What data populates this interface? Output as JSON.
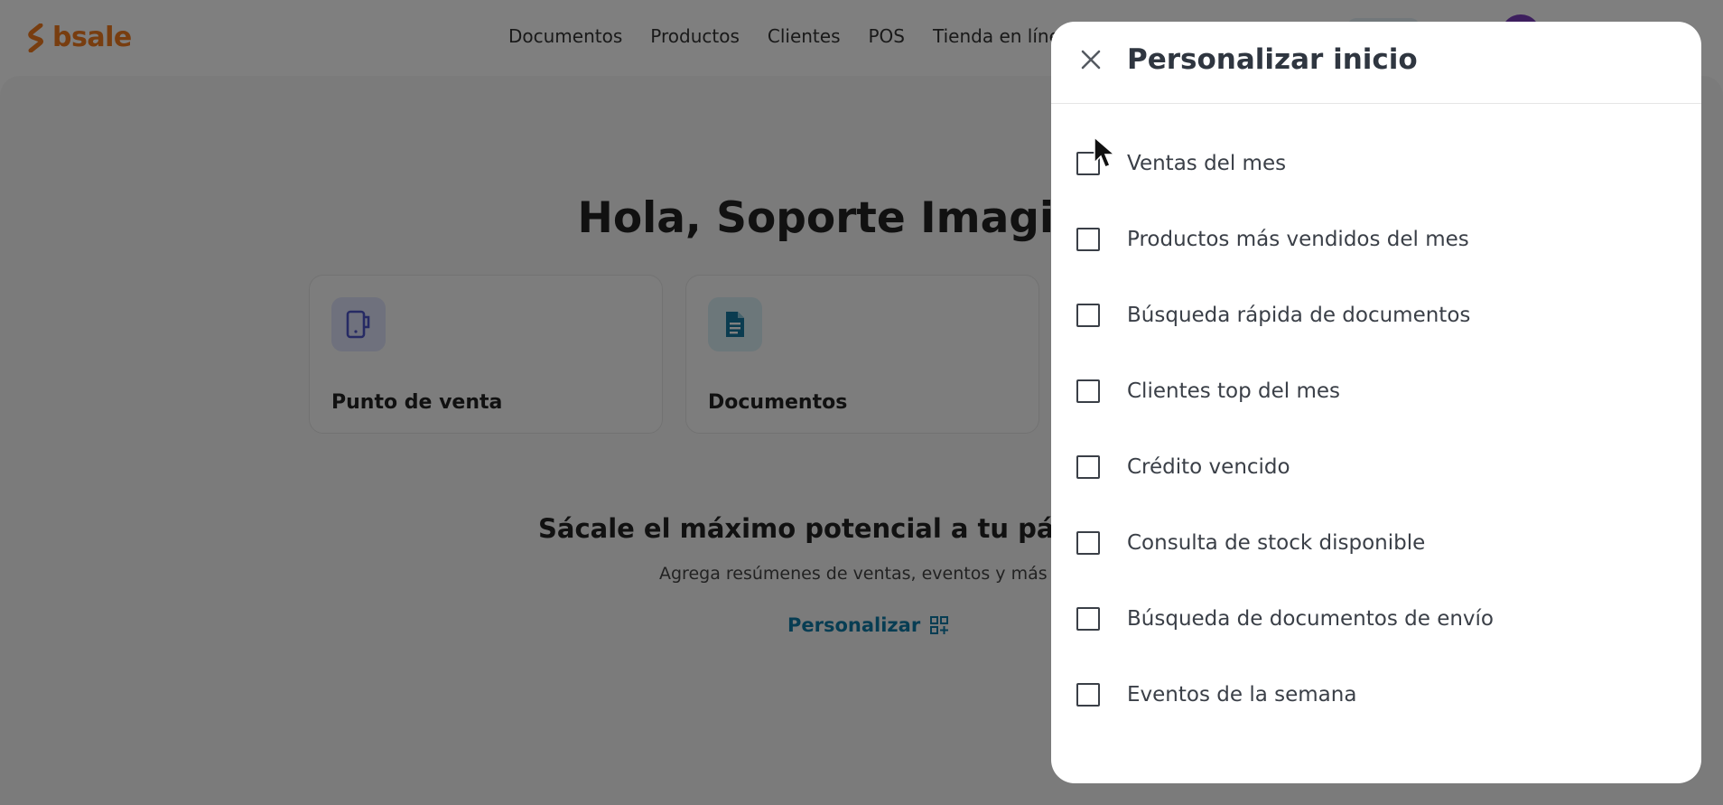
{
  "app": {
    "logo_text": "bsale",
    "brand_color": "#f07a1f",
    "accent_color": "#0f7aa6"
  },
  "nav": {
    "items": [
      "Documentos",
      "Productos",
      "Clientes",
      "POS",
      "Tienda en líne"
    ]
  },
  "home": {
    "greeting": "Hola, Soporte Imagin",
    "cards": [
      {
        "title": "Punto de venta",
        "icon": "pos-device-icon"
      },
      {
        "title": "Documentos",
        "icon": "document-icon"
      }
    ],
    "promo": {
      "title": "Sácale el máximo potencial a tu página",
      "subtitle": "Agrega resúmenes de ventas, eventos y más",
      "link_label": "Personalizar",
      "link_icon": "add-widget-icon"
    }
  },
  "drawer": {
    "title": "Personalizar inicio",
    "close_icon": "close-icon",
    "options": [
      {
        "label": "Ventas del mes",
        "checked": false
      },
      {
        "label": "Productos más vendidos del mes",
        "checked": false
      },
      {
        "label": "Búsqueda rápida de documentos",
        "checked": false
      },
      {
        "label": "Clientes top del mes",
        "checked": false
      },
      {
        "label": "Crédito vencido",
        "checked": false
      },
      {
        "label": "Consulta de stock disponible",
        "checked": false
      },
      {
        "label": "Búsqueda de documentos de envío",
        "checked": false
      },
      {
        "label": "Eventos de la semana",
        "checked": false
      }
    ]
  }
}
